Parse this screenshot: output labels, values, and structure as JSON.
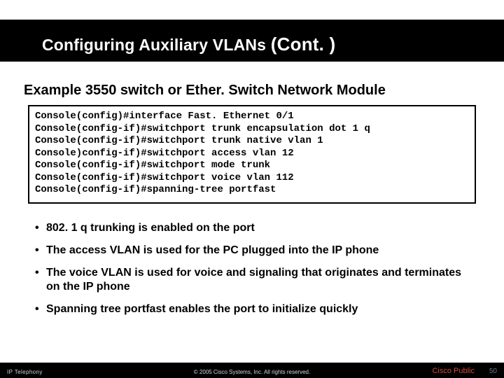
{
  "title": {
    "prefix": "Configuring Auxiliary VLANs ",
    "suffix": "(Cont. )"
  },
  "subtitle": "Example 3550 switch or Ether. Switch Network Module",
  "code_lines": [
    "Console(config)#interface Fast. Ethernet 0/1",
    "Console(config-if)#switchport trunk encapsulation dot 1 q",
    "Console(config-if)#switchport trunk native vlan 1",
    "Console)config-if)#switchport access vlan 12",
    "Console(config-if)#switchport mode trunk",
    "Console(config-if)#switchport voice vlan 112",
    "Console(config-if)#spanning-tree portfast"
  ],
  "bullets": [
    "802. 1 q trunking is enabled on the port",
    "The access VLAN is used for the PC plugged into the IP phone",
    "The voice VLAN is used for voice and signaling that originates and terminates on the IP phone",
    "Spanning tree portfast enables the port to initialize quickly"
  ],
  "footer": {
    "left": "IP Telephony",
    "center": "© 2005 Cisco Systems, Inc. All rights reserved.",
    "right": "Cisco Public",
    "page": "50"
  }
}
